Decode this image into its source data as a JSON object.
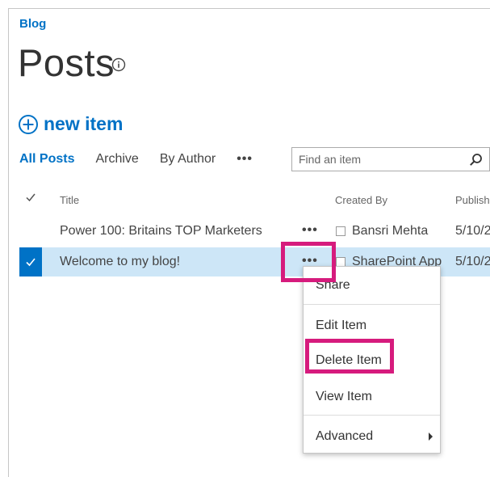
{
  "breadcrumb": "Blog",
  "page_title": "Posts",
  "new_item_label": "new item",
  "views": {
    "items": [
      "All Posts",
      "Archive",
      "By Author"
    ],
    "more": "•••"
  },
  "search": {
    "placeholder": "Find an item"
  },
  "columns": {
    "title": "Title",
    "created_by": "Created By",
    "published": "Publish"
  },
  "rows": [
    {
      "title": "Power 100: Britains TOP Marketers",
      "author": "Bansri Mehta",
      "date": "5/10/2",
      "ellipsis": "•••"
    },
    {
      "title": "Welcome to my blog!",
      "author": "SharePoint App",
      "date": "5/10/2",
      "ellipsis": "•••"
    }
  ],
  "context_menu": {
    "items": [
      "Share",
      "Edit Item",
      "Delete Item",
      "View Item",
      "Advanced"
    ]
  },
  "colors": {
    "accent": "#0072c6",
    "selected_row": "#cde6f7",
    "annotation_highlight": "#d61b7d"
  }
}
